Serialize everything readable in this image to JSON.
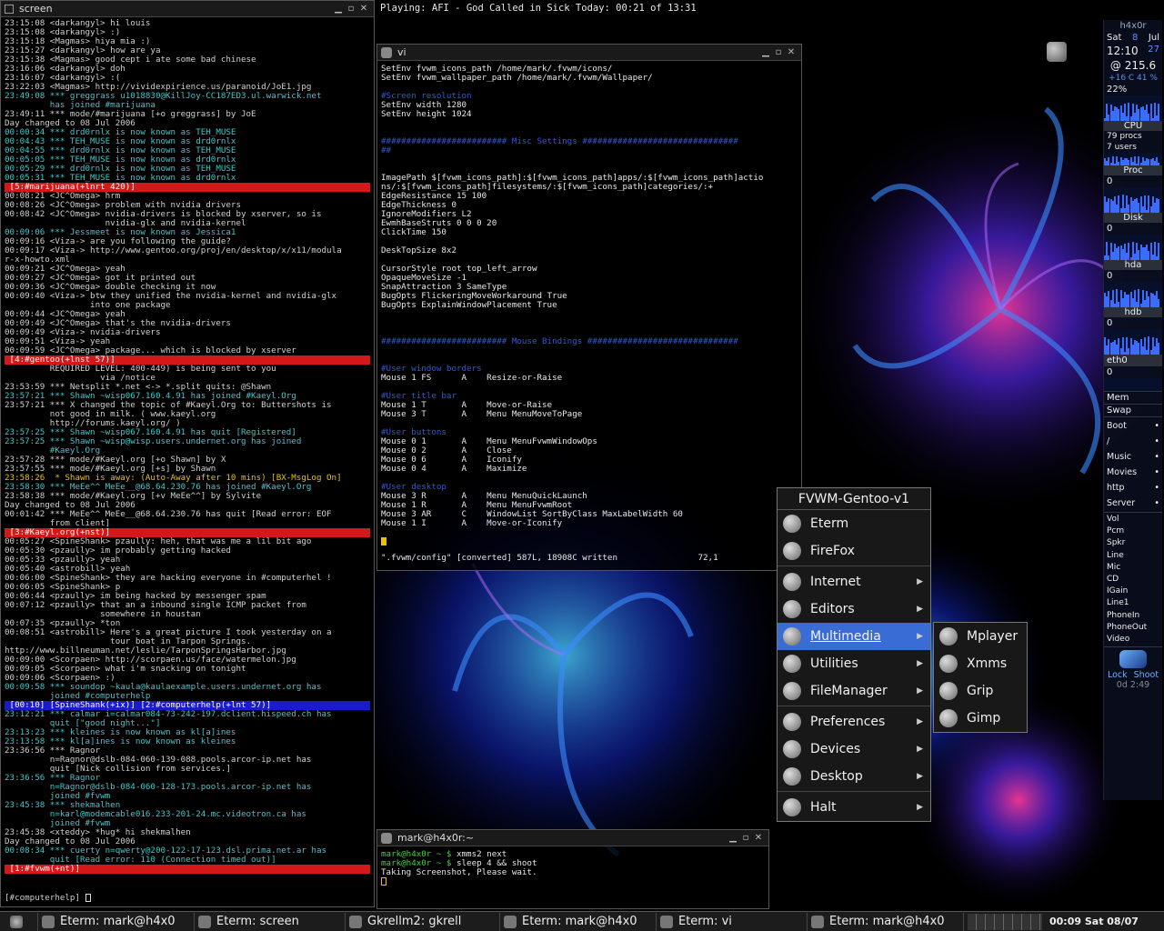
{
  "colors": {
    "accent": "#3a6cd6",
    "red_bar": "#d21818",
    "blue_bar": "#1b1bcc",
    "cyan": "#3fc8c8",
    "vi_comment": "#2b57e8"
  },
  "now_playing": "Playing: AFI - God Called in Sick Today: 00:21 of 13:31",
  "irc": {
    "title": "screen",
    "lines": [
      {
        "t": "23:15:08 <darkangyl> hi louis",
        "c": ""
      },
      {
        "t": "23:15:08 <darkangyl> :)",
        "c": ""
      },
      {
        "t": "23:15:18 <Magmas> hiya mia :)",
        "c": ""
      },
      {
        "t": "23:15:27 <darkangyl> how are ya",
        "c": ""
      },
      {
        "t": "23:15:38 <Magmas> good cept i ate some bad chinese",
        "c": ""
      },
      {
        "t": "23:16:06 <darkangyl> doh",
        "c": ""
      },
      {
        "t": "23:16:07 <darkangyl> :(",
        "c": ""
      },
      {
        "t": "23:22:03 <Magmas> http://vividexpirience.us/paranoid/JoE1.jpg",
        "c": ""
      },
      {
        "t": "23:49:08 *** greggrass u1018830@KillJoy-CC187ED3.ul.warwick.net",
        "c": "cyan"
      },
      {
        "t": "         has joined #marijuana",
        "c": "cyan"
      },
      {
        "t": "23:49:11 *** mode/#marijuana [+o greggrass] by JoE",
        "c": ""
      },
      {
        "t": "Day changed to 08 Jul 2006",
        "c": ""
      },
      {
        "t": "00:00:34 *** drd0rnlx is now known as TEH_MUSE",
        "c": "cyan"
      },
      {
        "t": "00:04:43 *** TEH_MUSE is now known as drd0rnlx",
        "c": "cyan"
      },
      {
        "t": "00:04:55 *** drd0rnlx is now known as TEH_MUSE",
        "c": "cyan"
      },
      {
        "t": "00:05:05 *** TEH_MUSE is now known as drd0rnlx",
        "c": "cyan"
      },
      {
        "t": "00:05:29 *** drd0rnlx is now known as TEH_MUSE",
        "c": "cyan"
      },
      {
        "t": "00:05:31 *** TEH_MUSE is now known as drd0rnlx",
        "c": "cyan"
      },
      {
        "t": " [5:#marijuana(+lnrt 420)]",
        "c": "bar-red"
      },
      {
        "t": "00:08:21 <JC^Omega> hrm",
        "c": ""
      },
      {
        "t": "00:08:26 <JC^Omega> problem with nvidia drivers",
        "c": ""
      },
      {
        "t": "00:08:42 <JC^Omega> nvidia-drivers is blocked by xserver, so is",
        "c": ""
      },
      {
        "t": "                    nvidia-glx and nvidia-kernel",
        "c": ""
      },
      {
        "t": "00:09:06 *** Jessmeet is now known as Jessica1",
        "c": "cyan"
      },
      {
        "t": "00:09:16 <Viza-> are you following the guide?",
        "c": ""
      },
      {
        "t": "00:09:17 <Viza-> http://www.gentoo.org/proj/en/desktop/x/x11/modula",
        "c": ""
      },
      {
        "t": "r-x-howto.xml",
        "c": ""
      },
      {
        "t": "00:09:21 <JC^Omega> yeah",
        "c": ""
      },
      {
        "t": "00:09:27 <JC^Omega> got it printed out",
        "c": ""
      },
      {
        "t": "00:09:36 <JC^Omega> double checking it now",
        "c": ""
      },
      {
        "t": "00:09:40 <Viza-> btw they unified the nvidia-kernel and nvidia-glx",
        "c": ""
      },
      {
        "t": "                 into one package",
        "c": ""
      },
      {
        "t": "00:09:44 <JC^Omega> yeah",
        "c": ""
      },
      {
        "t": "00:09:49 <JC^Omega> that's the nvidia-drivers",
        "c": ""
      },
      {
        "t": "00:09:49 <Viza-> nvidia-drivers",
        "c": ""
      },
      {
        "t": "00:09:51 <Viza-> yeah",
        "c": ""
      },
      {
        "t": "00:09:59 <JC^Omega> package... which is blocked by xserver",
        "c": ""
      },
      {
        "t": " [4:#gentoo(+lnst 57)]",
        "c": "bar-red"
      },
      {
        "t": "         REQUIRED LEVEL: 400-449) is being sent to you",
        "c": ""
      },
      {
        "t": "                   via /notice",
        "c": ""
      },
      {
        "t": "23:53:59 *** Netsplit *.net <-> *.split quits: @Shawn",
        "c": ""
      },
      {
        "t": "23:57:21 *** Shawn ~wisp067.160.4.91 has joined #Kaeyl.Org",
        "c": "cyan"
      },
      {
        "t": "23:57:21 *** X changed the topic of #Kaeyl.Org to: Buttershots is",
        "c": ""
      },
      {
        "t": "         not good in milk. ( www.kaeyl.org",
        "c": ""
      },
      {
        "t": "         http://forums.kaeyl.org/ )",
        "c": ""
      },
      {
        "t": "23:57:25 *** Shawn ~wisp067.160.4.91 has quit [Registered]",
        "c": "cyan"
      },
      {
        "t": "23:57:25 *** Shawn ~wisp@wisp.users.undernet.org has joined",
        "c": "cyan"
      },
      {
        "t": "         #Kaeyl.Org",
        "c": "cyan"
      },
      {
        "t": "23:57:28 *** mode/#Kaeyl.org [+o Shawn] by X",
        "c": ""
      },
      {
        "t": "23:57:55 *** mode/#Kaeyl.org [+s] by Shawn",
        "c": ""
      },
      {
        "t": "23:58:26  * Shawn is away: (Auto-Away after 10 mins) [BX-MsgLog On]",
        "c": "yellow"
      },
      {
        "t": "23:58:30 *** MeEe^^ MeEe__@68.64.230.76 has joined #Kaeyl.Org",
        "c": "cyan"
      },
      {
        "t": "23:58:38 *** mode/#Kaeyl.org [+v MeEe^^] by Sylvite",
        "c": ""
      },
      {
        "t": "Day changed to 08 Jul 2006",
        "c": ""
      },
      {
        "t": "00:01:42 *** MeEe^^ MeEe__@68.64.230.76 has quit [Read error: EOF",
        "c": ""
      },
      {
        "t": "         from client]",
        "c": ""
      },
      {
        "t": " [3:#Kaeyl.org(+nst)]",
        "c": "bar-red"
      },
      {
        "t": "00:05:27 <SpineShank> pzaully: heh, that was me a lil bit ago",
        "c": ""
      },
      {
        "t": "00:05:30 <pzaully> im probably getting hacked",
        "c": ""
      },
      {
        "t": "00:05:33 <pzaully> yeah",
        "c": ""
      },
      {
        "t": "00:05:40 <astrobill> yeah",
        "c": ""
      },
      {
        "t": "00:06:00 <SpineShank> they are hacking everyone in #computerhel !",
        "c": ""
      },
      {
        "t": "00:06:05 <SpineShank> p",
        "c": ""
      },
      {
        "t": "00:06:44 <pzaully> im being hacked by messenger spam",
        "c": ""
      },
      {
        "t": "00:07:12 <pzaully> that an a inbound single ICMP packet from",
        "c": ""
      },
      {
        "t": "                   somewhere in houstan",
        "c": ""
      },
      {
        "t": "00:07:35 <pzaully> *ton",
        "c": ""
      },
      {
        "t": "00:08:51 <astrobill> Here's a great picture I took yesterday on a",
        "c": ""
      },
      {
        "t": "                     tour boat in Tarpon Springs.",
        "c": ""
      },
      {
        "t": "http://www.billneuman.net/leslie/TarponSpringsHarbor.jpg",
        "c": ""
      },
      {
        "t": "00:09:00 <Scorpaen> http://scorpaen.us/face/watermelon.jpg",
        "c": ""
      },
      {
        "t": "00:09:05 <Scorpaen> what i'm snacking on tonight",
        "c": ""
      },
      {
        "t": "00:09:06 <Scorpaen> :)",
        "c": ""
      },
      {
        "t": "00:09:58 *** soundop ~kaula@kaulaexample.users.undernet.org has",
        "c": "cyan"
      },
      {
        "t": "         joined #computerhelp",
        "c": "cyan"
      },
      {
        "t": " [00:10] [SpineShank(+ix)] [2:#computerhelp(+lnt 57)]",
        "c": "bar-blue"
      },
      {
        "t": "23:12:21 *** calmar i=calmar084-73-242-197.dclient.hispeed.ch has",
        "c": "cyan"
      },
      {
        "t": "         quit [\"good night...\"]",
        "c": "cyan"
      },
      {
        "t": "23:13:23 *** kleines is now known as kl[a]ines",
        "c": "cyan"
      },
      {
        "t": "23:13:58 *** kl[a]ines is now known as kleines",
        "c": "cyan"
      },
      {
        "t": "23:36:56 *** Ragnor",
        "c": ""
      },
      {
        "t": "         n=Ragnor@dslb-084-060-139-088.pools.arcor-ip.net has",
        "c": ""
      },
      {
        "t": "         quit [Nick collision from services.]",
        "c": ""
      },
      {
        "t": "23:36:56 *** Ragnor",
        "c": "cyan"
      },
      {
        "t": "         n=Ragnor@dslb-084-060-128-173.pools.arcor-ip.net has",
        "c": "cyan"
      },
      {
        "t": "         joined #fvwm",
        "c": "cyan"
      },
      {
        "t": "23:45:38 *** shekmalhen",
        "c": "cyan"
      },
      {
        "t": "         n=karl@modemcable016.233-201-24.mc.videotron.ca has",
        "c": "cyan"
      },
      {
        "t": "         joined #fvwm",
        "c": "cyan"
      },
      {
        "t": "23:45:38 <xteddy> *hug* hi shekmalhen",
        "c": ""
      },
      {
        "t": "Day changed to 08 Jul 2006",
        "c": ""
      },
      {
        "t": "00:08:34 *** cuerty n=qwerty@200-122-17-123.dsl.prima.net.ar has",
        "c": "cyan"
      },
      {
        "t": "         quit [Read error: 110 (Connection timed out)]",
        "c": "cyan"
      },
      {
        "t": " [1:#fvwm(+nt)]",
        "c": "bar-red"
      }
    ],
    "input": "[#computerhelp] "
  },
  "vi": {
    "title": "vi",
    "lines": [
      {
        "t": "SetEnv fvwm_icons_path /home/mark/.fvwm/icons/",
        "c": ""
      },
      {
        "t": "SetEnv fvwm_wallpaper_path /home/mark/.fvwm/Wallpaper/",
        "c": ""
      },
      {
        "t": "",
        "c": ""
      },
      {
        "t": "#Screen resolution",
        "c": "cmt"
      },
      {
        "t": "SetEnv width 1280",
        "c": ""
      },
      {
        "t": "SetEnv height 1024",
        "c": ""
      },
      {
        "t": "",
        "c": ""
      },
      {
        "t": "",
        "c": ""
      },
      {
        "t": "######################### Misc Settings ###############################",
        "c": "cmt"
      },
      {
        "t": "##",
        "c": "cmt"
      },
      {
        "t": "",
        "c": ""
      },
      {
        "t": "",
        "c": ""
      },
      {
        "t": "ImagePath $[fvwm_icons_path]:$[fvwm_icons_path]apps/:$[fvwm_icons_path]actio",
        "c": ""
      },
      {
        "t": "ns/:$[fvwm_icons_path]filesystems/:$[fvwm_icons_path]categories/:+",
        "c": ""
      },
      {
        "t": "EdgeResistance 15 100",
        "c": ""
      },
      {
        "t": "EdgeThickness 0",
        "c": ""
      },
      {
        "t": "IgnoreModifiers L2",
        "c": ""
      },
      {
        "t": "EwmhBaseStruts 0 0 0 20",
        "c": ""
      },
      {
        "t": "ClickTime 150",
        "c": ""
      },
      {
        "t": "",
        "c": ""
      },
      {
        "t": "DeskTopSize 8x2",
        "c": ""
      },
      {
        "t": "",
        "c": ""
      },
      {
        "t": "CursorStyle root top_left_arrow",
        "c": ""
      },
      {
        "t": "OpaqueMoveSize -1",
        "c": ""
      },
      {
        "t": "SnapAttraction 3 SameType",
        "c": ""
      },
      {
        "t": "BugOpts FlickeringMoveWorkaround True",
        "c": ""
      },
      {
        "t": "BugOpts ExplainWindowPlacement True",
        "c": ""
      },
      {
        "t": "",
        "c": ""
      },
      {
        "t": "",
        "c": ""
      },
      {
        "t": "",
        "c": ""
      },
      {
        "t": "######################### Mouse Bindings ##############################",
        "c": "cmt"
      },
      {
        "t": "",
        "c": ""
      },
      {
        "t": "",
        "c": ""
      },
      {
        "t": "#User window borders",
        "c": "cmt"
      },
      {
        "t": "Mouse 1 FS      A    Resize-or-Raise",
        "c": ""
      },
      {
        "t": "",
        "c": ""
      },
      {
        "t": "#User title bar",
        "c": "cmt"
      },
      {
        "t": "Mouse 1 T       A    Move-or-Raise",
        "c": ""
      },
      {
        "t": "Mouse 3 T       A    Menu MenuMoveToPage",
        "c": ""
      },
      {
        "t": "",
        "c": ""
      },
      {
        "t": "#User buttons",
        "c": "cmt"
      },
      {
        "t": "Mouse 0 1       A    Menu MenuFvwmWindowOps",
        "c": ""
      },
      {
        "t": "Mouse 0 2       A    Close",
        "c": ""
      },
      {
        "t": "Mouse 0 6       A    Iconify",
        "c": ""
      },
      {
        "t": "Mouse 0 4       A    Maximize",
        "c": ""
      },
      {
        "t": "",
        "c": ""
      },
      {
        "t": "#User desktop",
        "c": "cmt"
      },
      {
        "t": "Mouse 3 R       A    Menu MenuQuickLaunch",
        "c": ""
      },
      {
        "t": "Mouse 1 R       A    Menu MenuFvwmRoot",
        "c": ""
      },
      {
        "t": "Mouse 3 AR      C    WindowList SortByClass MaxLabelWidth 60",
        "c": ""
      },
      {
        "t": "Mouse 1 I       A    Move-or-Iconify",
        "c": ""
      },
      {
        "t": "",
        "c": ""
      }
    ],
    "status": "\".fvwm/config\" [converted] 587L, 18908C written                72,1"
  },
  "shell": {
    "title": "mark@h4x0r:~",
    "lines": [
      {
        "p": "mark@h4x0r ~ $ ",
        "cmd": "xmms2 next"
      },
      {
        "p": "mark@h4x0r ~ $ ",
        "cmd": "sleep 4 && shoot"
      },
      {
        "p": "",
        "cmd": "Taking Screenshot, Please wait."
      }
    ]
  },
  "menu": {
    "title": "FVWM-Gentoo-v1",
    "items": [
      {
        "label": "Eterm",
        "icon": "terminal-icon",
        "sub": false,
        "group": 1
      },
      {
        "label": "FireFox",
        "icon": "firefox-icon",
        "sub": false,
        "group": 1
      },
      {
        "label": "Internet",
        "icon": "globe-icon",
        "sub": true,
        "group": 2
      },
      {
        "label": "Editors",
        "icon": "editor-icon",
        "sub": true,
        "group": 2
      },
      {
        "label": "Multimedia",
        "icon": "multimedia-icon",
        "sub": true,
        "group": 2,
        "active": true
      },
      {
        "label": "Utilities",
        "icon": "utilities-icon",
        "sub": true,
        "group": 2
      },
      {
        "label": "FileManager",
        "icon": "filemanager-icon",
        "sub": true,
        "group": 2
      },
      {
        "label": "Preferences",
        "icon": "preferences-icon",
        "sub": true,
        "group": 3
      },
      {
        "label": "Devices",
        "icon": "devices-icon",
        "sub": true,
        "group": 3
      },
      {
        "label": "Desktop",
        "icon": "desktop-icon",
        "sub": true,
        "group": 3
      },
      {
        "label": "Halt",
        "icon": "halt-icon",
        "sub": true,
        "group": 4
      }
    ],
    "submenu": [
      {
        "label": "Mplayer",
        "icon": "mplayer-icon"
      },
      {
        "label": "Xmms",
        "icon": "xmms-icon"
      },
      {
        "label": "Grip",
        "icon": "grip-icon"
      },
      {
        "label": "Gimp",
        "icon": "gimp-icon"
      }
    ]
  },
  "gkrellm": {
    "host": "h4x0r",
    "day": "Sat",
    "date_num": "8",
    "month": "Jul",
    "time": "12:10",
    "seconds": "27",
    "temp": "@ 215.6",
    "temp2": "+16 C 41 %",
    "load_pct": "22%",
    "cpu_label": "CPU",
    "procs": "79 procs",
    "users": "7 users",
    "proc_label": "Proc",
    "proc_val": "0",
    "disk_label": "Disk",
    "disk_val": "0",
    "hda_label": "hda",
    "hda_val": "0",
    "hdb_label": "hdb",
    "hdb_val": "0",
    "eth_label": "eth0",
    "eth_val": "0",
    "mem_label": "Mem",
    "swap_label": "Swap",
    "mounts": [
      "Boot",
      "/",
      "Music",
      "Movies",
      "http",
      "Server"
    ],
    "mixer": [
      "Vol",
      "Pcm",
      "Spkr",
      "Line",
      "Mic",
      "CD",
      "IGain",
      "Line1",
      "PhoneIn",
      "PhoneOut",
      "Video"
    ],
    "lock_label": "Lock",
    "shoot_label": "Shoot",
    "uptime": "0d 2:49"
  },
  "taskbar": {
    "tasks": [
      "Eterm: mark@h4x0",
      "Eterm: screen",
      "Gkrellm2: gkrell",
      "Eterm: mark@h4x0",
      "Eterm: vi",
      "Eterm: mark@h4x0"
    ],
    "clock": "00:09  Sat  08/07"
  }
}
